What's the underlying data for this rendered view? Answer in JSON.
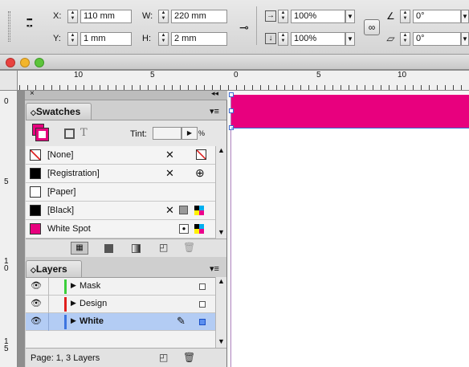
{
  "control_bar": {
    "x_label": "X:",
    "x_value": "110 mm",
    "y_label": "Y:",
    "y_value": "1 mm",
    "w_label": "W:",
    "w_value": "220 mm",
    "h_label": "H:",
    "h_value": "2 mm",
    "scale_x": "100%",
    "scale_y": "100%",
    "rotate": "0°",
    "shear": "0°"
  },
  "ruler_left": {
    "labels": [
      "10",
      "5"
    ]
  },
  "ruler_doc": {
    "labels": [
      "0",
      "5",
      "10"
    ]
  },
  "vruler": {
    "labels": [
      "0",
      "5",
      "1 0",
      "1 5"
    ]
  },
  "swatches": {
    "title": "Swatches",
    "tint_label": "Tint:",
    "tint_value": "",
    "percent": "%",
    "items": [
      {
        "name": "[None]"
      },
      {
        "name": "[Registration]"
      },
      {
        "name": "[Paper]"
      },
      {
        "name": "[Black]"
      },
      {
        "name": "White Spot"
      }
    ]
  },
  "layers": {
    "title": "Layers",
    "items": [
      {
        "name": "Mask",
        "color": "#3ccf3c"
      },
      {
        "name": "Design",
        "color": "#e0201e"
      },
      {
        "name": "White",
        "color": "#3c74e0"
      }
    ],
    "status": "Page: 1, 3 Layers"
  },
  "colors": {
    "magenta": "#e8007e",
    "selection": "#b3ccf4"
  }
}
